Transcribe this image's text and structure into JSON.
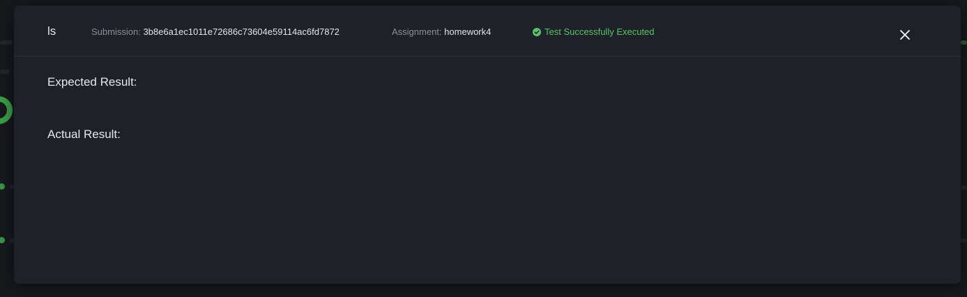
{
  "modal": {
    "title": "ls",
    "submission_label": "Submission:",
    "submission_value": "3b8e6a1ec1011e72686c73604e59114ac6fd7872",
    "assignment_label": "Assignment:",
    "assignment_value": "homework4",
    "status_text": "Test Successfully Executed",
    "status_icon": "check-circle-icon",
    "close_icon": "close-icon",
    "expected_label": "Expected Result:",
    "actual_label": "Actual Result:"
  },
  "colors": {
    "modal_bg": "#1f2128",
    "success": "#56c46a",
    "label": "#8b8f98",
    "text": "#e4e5e8"
  }
}
